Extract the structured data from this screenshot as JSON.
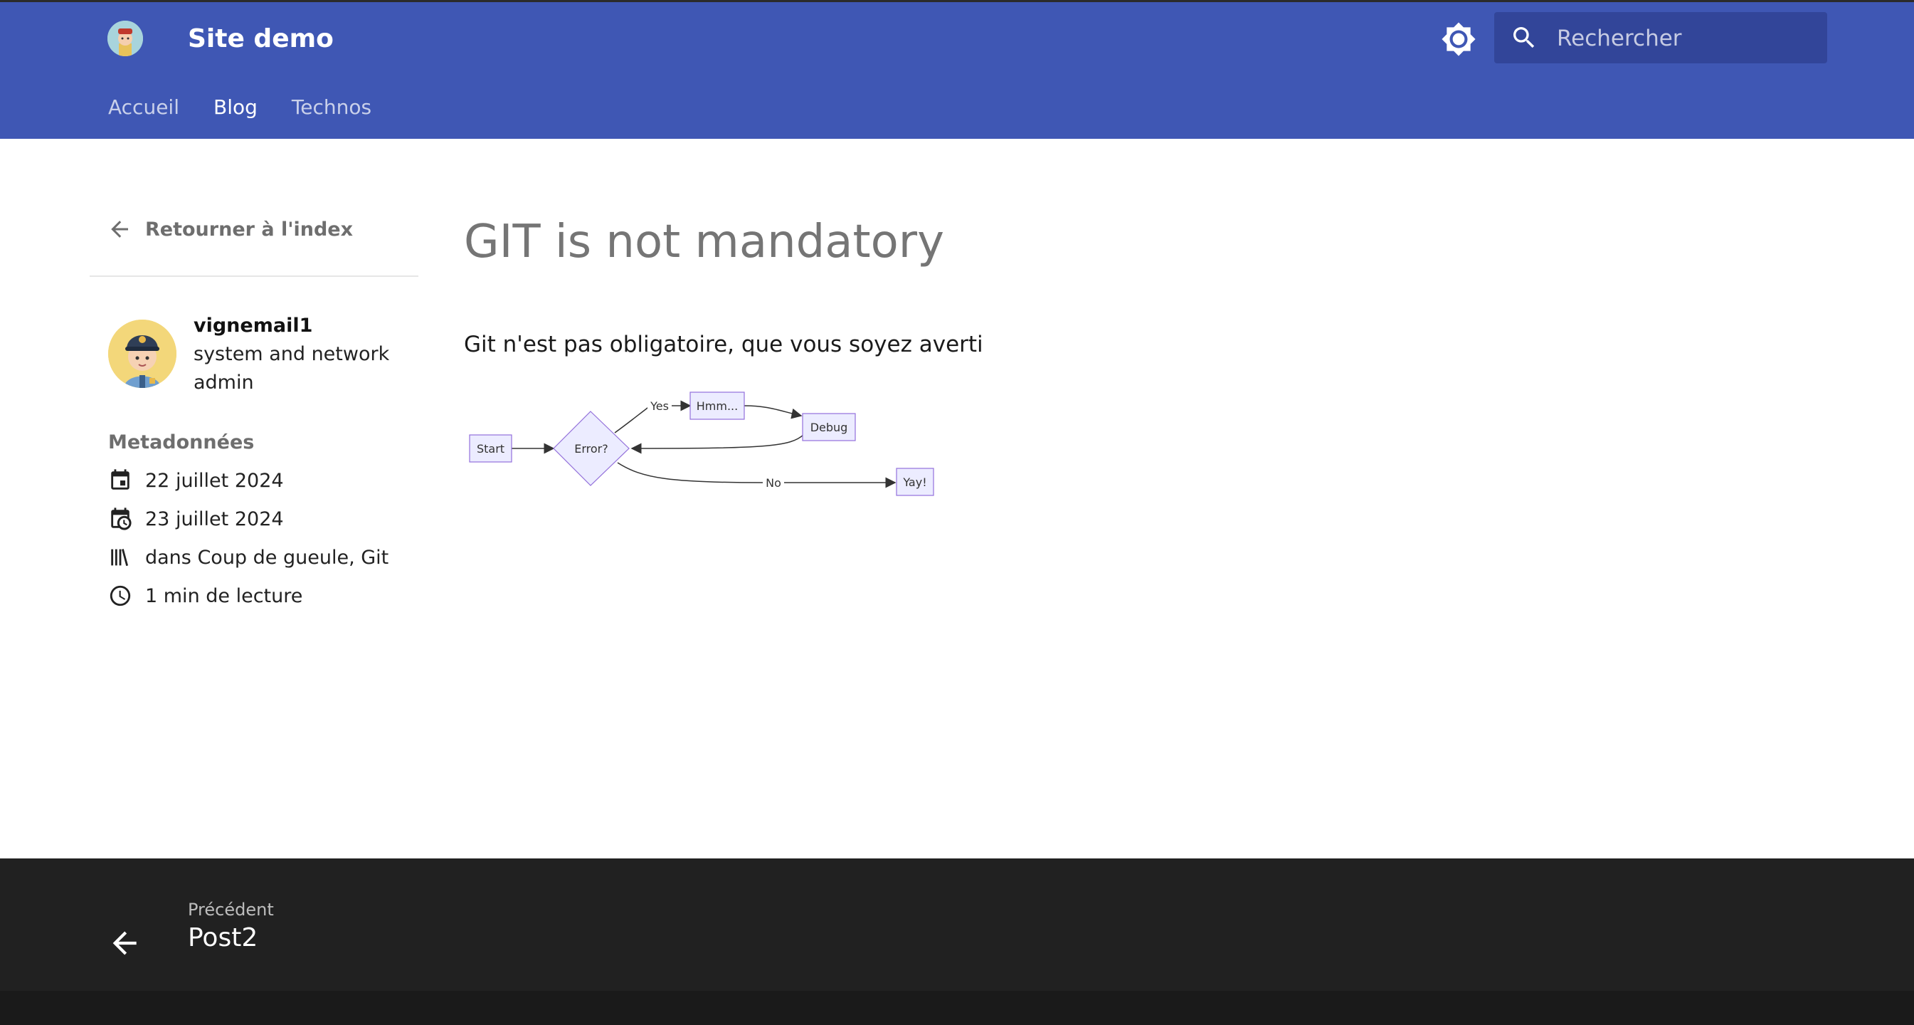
{
  "header": {
    "site_title": "Site demo",
    "search_placeholder": "Rechercher",
    "brand_color": "#3f57b4",
    "icons": [
      "site-logo",
      "theme-toggle-icon",
      "search-icon"
    ]
  },
  "nav": {
    "tabs": [
      {
        "label": "Accueil",
        "active": false
      },
      {
        "label": "Blog",
        "active": true
      },
      {
        "label": "Technos",
        "active": false
      }
    ]
  },
  "sidebar": {
    "back_label": "Retourner à l'index",
    "author": {
      "name": "vignemail1",
      "bio": "system and network admin"
    },
    "meta_heading": "Metadonnées",
    "meta": [
      {
        "icon": "calendar-icon",
        "text": "22 juillet 2024"
      },
      {
        "icon": "calendar-clock-icon",
        "text": "23 juillet 2024"
      },
      {
        "icon": "library-icon",
        "text": "dans Coup de gueule, Git"
      },
      {
        "icon": "clock-icon",
        "text": "1 min de lecture"
      }
    ]
  },
  "article": {
    "title": "GIT is not mandatory",
    "text": "Git n'est pas obligatoire, que vous soyez averti",
    "flowchart": {
      "nodes": {
        "start": "Start",
        "error": "Error?",
        "hmm": "Hmm...",
        "debug": "Debug",
        "yay": "Yay!"
      },
      "edges": {
        "yes": "Yes",
        "no": "No"
      }
    }
  },
  "footer": {
    "prev_label": "Précédent",
    "prev_title": "Post2"
  }
}
